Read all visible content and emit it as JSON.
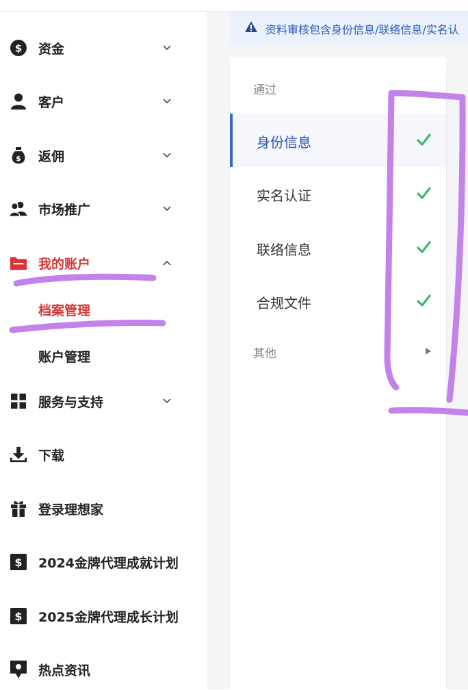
{
  "sidebar": {
    "items": [
      {
        "label": "资金",
        "icon": "dollar-circle-icon",
        "has_chevron": true
      },
      {
        "label": "客户",
        "icon": "person-icon",
        "has_chevron": true
      },
      {
        "label": "返佣",
        "icon": "money-bag-icon",
        "has_chevron": true
      },
      {
        "label": "市场推广",
        "icon": "users-icon",
        "has_chevron": true
      },
      {
        "label": "我的账户",
        "icon": "folder-icon",
        "expanded": true,
        "active": true
      },
      {
        "label": "服务与支持",
        "icon": "grid-icon",
        "has_chevron": true
      },
      {
        "label": "下载",
        "icon": "download-icon"
      },
      {
        "label": "登录理想家",
        "icon": "gift-icon"
      },
      {
        "label": "2024金牌代理成就计划",
        "icon": "dollar-card-icon"
      },
      {
        "label": "2025金牌代理成长计划",
        "icon": "dollar-card-icon"
      },
      {
        "label": "热点资讯",
        "icon": "map-pin-icon"
      }
    ],
    "subitems": [
      {
        "label": "档案管理",
        "active": true
      },
      {
        "label": "账户管理"
      }
    ]
  },
  "alert": {
    "text": "资料审核包含身份信息/联络信息/实名认",
    "icon": "warning-icon"
  },
  "review": {
    "passed_label": "通过",
    "passed_items": [
      {
        "label": "身份信息",
        "status": "check",
        "selected": true
      },
      {
        "label": "实名认证",
        "status": "check"
      },
      {
        "label": "联络信息",
        "status": "check"
      },
      {
        "label": "合规文件",
        "status": "check"
      }
    ],
    "other_label": "其他"
  },
  "colors": {
    "active_red": "#d83535",
    "check_green": "#3fb56b",
    "accent_blue": "#3c64c8",
    "highlight_purple": "#c07ce8"
  }
}
